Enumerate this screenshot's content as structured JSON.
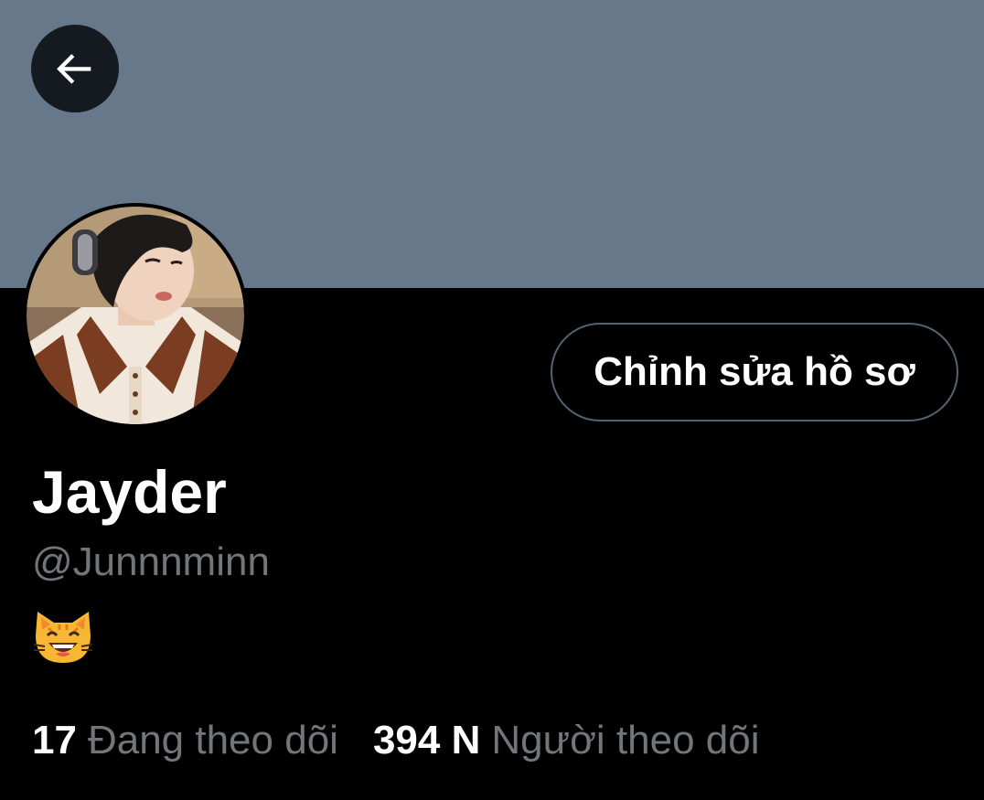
{
  "header": {
    "back_icon": "arrow-left-icon"
  },
  "profile": {
    "display_name": "Jayder",
    "handle": "@Junnnminn",
    "bio_emoji": "grinning-cat-icon",
    "edit_button_label": "Chỉnh sửa hồ sơ"
  },
  "stats": {
    "following_count": "17",
    "following_label": "Đang theo dõi",
    "followers_count": "394 N",
    "followers_label": "Người theo dõi"
  },
  "colors": {
    "banner": "#66788a",
    "background": "#000000",
    "text_primary": "#ffffff",
    "text_secondary": "#71767b",
    "button_border": "#536471"
  }
}
